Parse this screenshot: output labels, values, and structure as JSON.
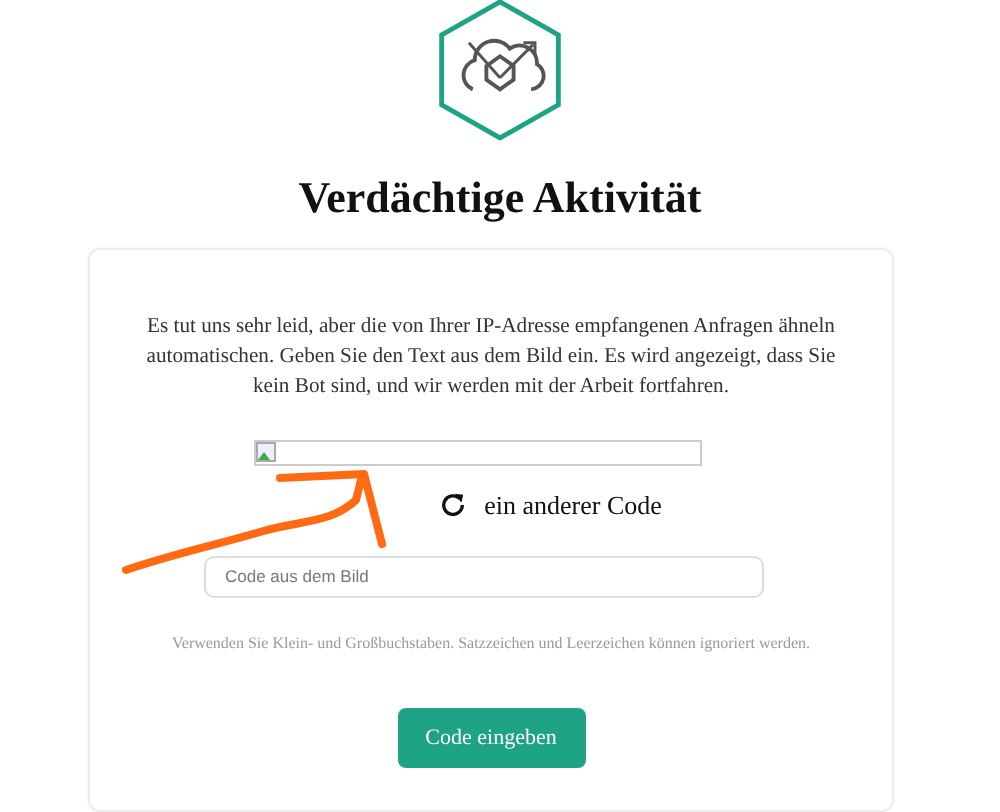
{
  "title": "Verdächtige Aktivität",
  "message": "Es tut uns sehr leid, aber die von Ihrer IP-Adresse empfangenen Anfragen ähneln automatischen. Geben Sie den Text aus dem Bild ein. Es wird angezeigt, dass Sie kein Bot sind, und wir werden mit der Arbeit fortfahren.",
  "captcha": {
    "kind": "broken-image"
  },
  "refresh_link": "ein anderer Code",
  "code_field": {
    "placeholder": "Code aus dem Bild"
  },
  "hint": "Verwenden Sie Klein- und Großbuchstaben. Satzzeichen und Leerzeichen können ignoriert werden.",
  "submit_button": "Code eingeben",
  "annotation": {
    "kind": "arrow",
    "color": "#ff6a13"
  }
}
